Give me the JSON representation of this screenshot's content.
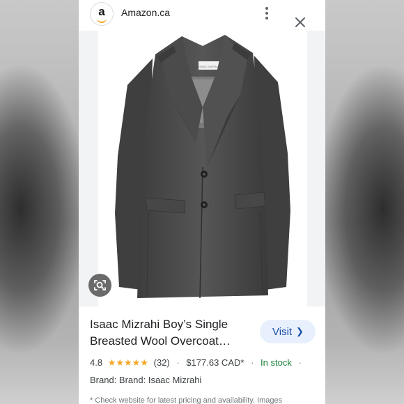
{
  "header": {
    "site_logo_letter": "a",
    "site_name": "Amazon.ca",
    "more_icon": "more-vert-icon",
    "close_icon": "close-icon"
  },
  "image": {
    "label_tag_text": "ISAAC MIZRAHI",
    "lens_icon": "lens-icon",
    "coat_color": "#4a4a4a"
  },
  "product": {
    "title_line1": "Isaac Mizrahi Boy’s Single",
    "title_line2": "Breasted Wool Overcoat…",
    "visit_label": "Visit",
    "rating": "4.8",
    "stars": "★★★★★",
    "review_count": "(32)",
    "price": "$177.63 CAD*",
    "stock": "In stock",
    "brand": "Brand: Brand: Isaac Mizrahi",
    "footnote": "* Check website for latest pricing and availability. Images"
  },
  "colors": {
    "accent_blue": "#174ea6",
    "visit_bg": "#e8f0fe",
    "star": "#f5a623",
    "in_stock": "#188038"
  }
}
